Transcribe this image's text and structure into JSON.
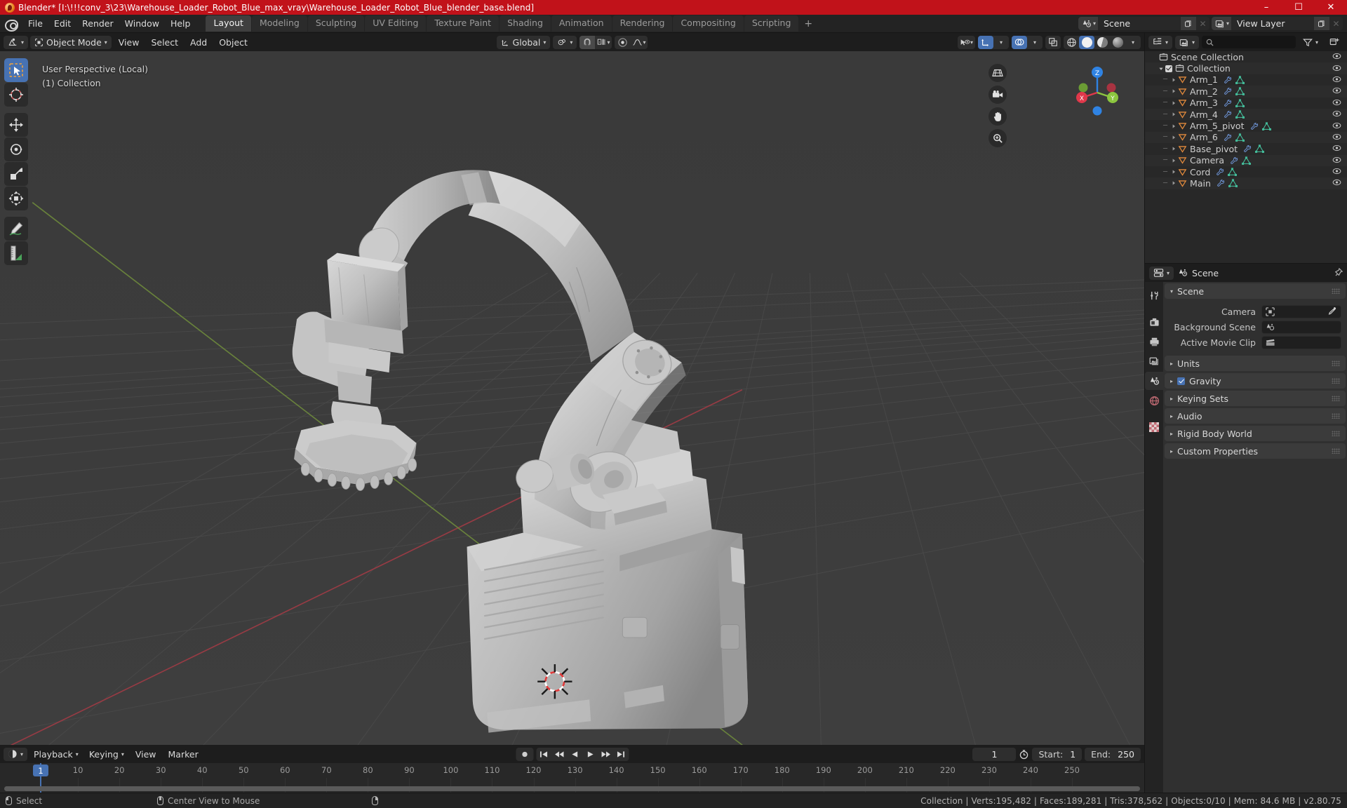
{
  "window": {
    "title": "Blender* [I:\\!!!conv_3\\23\\Warehouse_Loader_Robot_Blue_max_vray\\Warehouse_Loader_Robot_Blue_blender_base.blend]",
    "minimize": "–",
    "maximize": "☐",
    "close": "✕"
  },
  "topbar": {
    "menus": [
      "File",
      "Edit",
      "Render",
      "Window",
      "Help"
    ],
    "workspaces": [
      {
        "label": "Layout",
        "active": true
      },
      {
        "label": "Modeling",
        "active": false
      },
      {
        "label": "Sculpting",
        "active": false
      },
      {
        "label": "UV Editing",
        "active": false
      },
      {
        "label": "Texture Paint",
        "active": false
      },
      {
        "label": "Shading",
        "active": false
      },
      {
        "label": "Animation",
        "active": false
      },
      {
        "label": "Rendering",
        "active": false
      },
      {
        "label": "Compositing",
        "active": false
      },
      {
        "label": "Scripting",
        "active": false
      }
    ],
    "add_workspace": "+",
    "scene_name": "Scene",
    "view_layer_name": "View Layer"
  },
  "viewport_header": {
    "mode": "Object Mode",
    "menus": [
      "View",
      "Select",
      "Add",
      "Object"
    ],
    "transform_orientation": "Global"
  },
  "viewport": {
    "perspective_label": "User Perspective (Local)",
    "collection_label": "(1) Collection",
    "background_color": "#3c3c3c",
    "axis_x": "X",
    "axis_y": "Y",
    "axis_z": "Z",
    "gizmo_x_color": "#e0384a",
    "gizmo_y_color": "#8cc63f",
    "gizmo_z_color": "#2f83e3",
    "grid_color": "#4a4a4a",
    "x_axis_line_color": "#9c3b45",
    "y_axis_line_color": "#6e8a3c",
    "tools": [
      {
        "name": "select-box-tool",
        "active": true
      },
      {
        "name": "cursor-tool",
        "active": false
      },
      {
        "name": "move-tool",
        "active": false
      },
      {
        "name": "rotate-tool",
        "active": false
      },
      {
        "name": "scale-tool",
        "active": false
      },
      {
        "name": "transform-tool",
        "active": false
      },
      {
        "name": "annotate-tool",
        "active": false
      },
      {
        "name": "measure-tool",
        "active": false
      }
    ]
  },
  "outliner": {
    "search_placeholder": "",
    "rows": [
      {
        "label": "Scene Collection",
        "depth": 0,
        "icon": "collection-icon",
        "has_disclosure": false,
        "has_check": false,
        "modifiers": false,
        "eye": true
      },
      {
        "label": "Collection",
        "depth": 1,
        "icon": "collection-icon",
        "has_disclosure": true,
        "has_check": true,
        "modifiers": false,
        "eye": true
      },
      {
        "label": "Arm_1",
        "depth": 2,
        "icon": "object-icon",
        "has_disclosure": true,
        "has_check": false,
        "modifiers": true,
        "eye": true
      },
      {
        "label": "Arm_2",
        "depth": 2,
        "icon": "object-icon",
        "has_disclosure": true,
        "has_check": false,
        "modifiers": true,
        "eye": true
      },
      {
        "label": "Arm_3",
        "depth": 2,
        "icon": "object-icon",
        "has_disclosure": true,
        "has_check": false,
        "modifiers": true,
        "eye": true
      },
      {
        "label": "Arm_4",
        "depth": 2,
        "icon": "object-icon",
        "has_disclosure": true,
        "has_check": false,
        "modifiers": true,
        "eye": true
      },
      {
        "label": "Arm_5_pivot",
        "depth": 2,
        "icon": "object-icon",
        "has_disclosure": true,
        "has_check": false,
        "modifiers": true,
        "eye": true
      },
      {
        "label": "Arm_6",
        "depth": 2,
        "icon": "object-icon",
        "has_disclosure": true,
        "has_check": false,
        "modifiers": true,
        "eye": true
      },
      {
        "label": "Base_pivot",
        "depth": 2,
        "icon": "object-icon",
        "has_disclosure": true,
        "has_check": false,
        "modifiers": true,
        "eye": true
      },
      {
        "label": "Camera",
        "depth": 2,
        "icon": "object-icon",
        "has_disclosure": true,
        "has_check": false,
        "modifiers": true,
        "eye": true
      },
      {
        "label": "Cord",
        "depth": 2,
        "icon": "object-icon",
        "has_disclosure": true,
        "has_check": false,
        "modifiers": true,
        "eye": true
      },
      {
        "label": "Main",
        "depth": 2,
        "icon": "object-icon",
        "has_disclosure": true,
        "has_check": false,
        "modifiers": true,
        "eye": true
      }
    ]
  },
  "properties": {
    "breadcrumb": "Scene",
    "tabs": [
      {
        "name": "tool-tab",
        "active": false
      },
      {
        "name": "render-tab",
        "active": false
      },
      {
        "name": "output-tab",
        "active": false
      },
      {
        "name": "view-layer-tab",
        "active": false
      },
      {
        "name": "scene-tab",
        "active": true
      },
      {
        "name": "world-tab",
        "active": false
      },
      {
        "name": "texture-tab",
        "active": false
      }
    ],
    "scene_panel_title": "Scene",
    "fields": [
      {
        "label": "Camera",
        "value": "",
        "icon": "camera-icon",
        "eyedropper": true
      },
      {
        "label": "Background Scene",
        "value": "",
        "icon": "scene-icon",
        "eyedropper": false
      },
      {
        "label": "Active Movie Clip",
        "value": "",
        "icon": "clip-icon",
        "eyedropper": false
      }
    ],
    "panels": [
      {
        "label": "Units",
        "checkbox": false,
        "checked": false
      },
      {
        "label": "Gravity",
        "checkbox": true,
        "checked": true
      },
      {
        "label": "Keying Sets",
        "checkbox": false,
        "checked": false
      },
      {
        "label": "Audio",
        "checkbox": false,
        "checked": false
      },
      {
        "label": "Rigid Body World",
        "checkbox": false,
        "checked": false
      },
      {
        "label": "Custom Properties",
        "checkbox": false,
        "checked": false
      }
    ]
  },
  "timeline": {
    "menus": [
      "Playback",
      "Keying",
      "View",
      "Marker"
    ],
    "current_frame": "1",
    "start_label": "Start:",
    "start_value": "1",
    "end_label": "End:",
    "end_value": "250",
    "ticks": [
      "1",
      "10",
      "20",
      "30",
      "40",
      "50",
      "60",
      "70",
      "80",
      "90",
      "100",
      "110",
      "120",
      "130",
      "140",
      "150",
      "160",
      "170",
      "180",
      "190",
      "200",
      "210",
      "220",
      "230",
      "240",
      "250"
    ],
    "playhead_color": "#4772b3"
  },
  "statusbar": {
    "left_items": [
      {
        "icon": "mouse-left-icon",
        "label": "Select"
      },
      {
        "icon": "mouse-middle-icon",
        "label": "Center View to Mouse"
      },
      {
        "icon": "mouse-right-icon",
        "label": ""
      }
    ],
    "stats": "Collection | Verts:195,482 | Faces:189,281 | Tris:378,562 | Objects:0/10 | Mem: 84.6 MB | v2.80.75"
  }
}
